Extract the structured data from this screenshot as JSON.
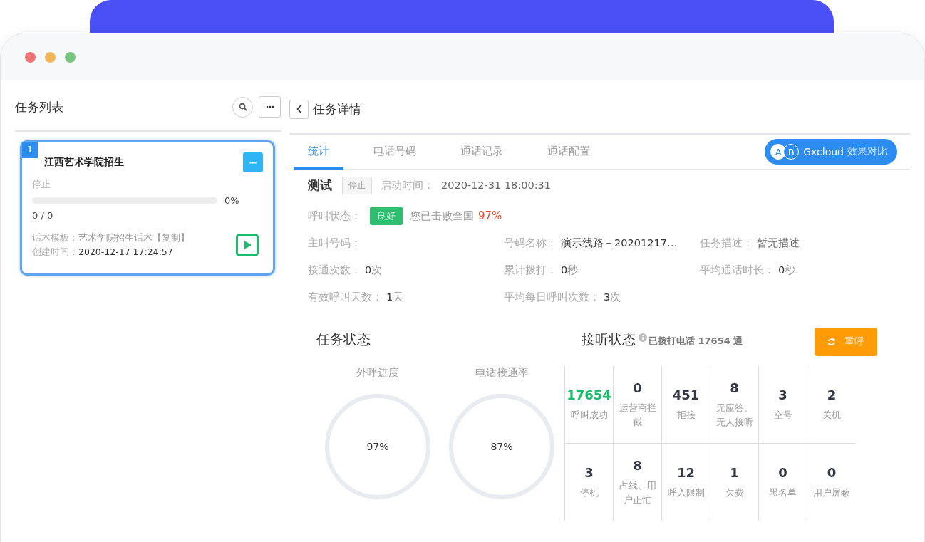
{
  "task_list": {
    "title": "任务列表",
    "tasks": [
      {
        "index": "1",
        "name": "江西艺术学院招生",
        "status": "停止",
        "level": 0,
        "percent": "0%",
        "count": "0 / 0",
        "script_label": "话术模板：",
        "script": "艺术学院招生话术【复制】",
        "created_label": "创建时间：",
        "created": "2020-12-17 17:24:57",
        "selected": true
      }
    ]
  },
  "detail": {
    "title": "任务详情",
    "tabs": [
      {
        "label": "统计",
        "selected": true
      },
      {
        "label": "电话号码",
        "selected": false
      },
      {
        "label": "通话记录",
        "selected": false
      },
      {
        "label": "通话配置",
        "selected": false
      }
    ],
    "compare_button": {
      "a": "A",
      "b": "B",
      "label": "Gxcloud",
      "suffix": "效果对比"
    },
    "task_name": "测试",
    "task_status": "停止",
    "start_label": "启动时间：",
    "start_time": "2020-12-31 18:00:31",
    "call_status_label": "呼叫状态：",
    "call_status": "良好",
    "beat_text": "您已击败全国",
    "beat_percent": "97%",
    "info_rows": [
      [
        {
          "label": "主叫号码："
        },
        {
          "label": "号码名称：",
          "value": "演示线路－20201217…"
        },
        {
          "label": "任务描述：",
          "value": "暂无描述",
          "muted": true
        }
      ],
      [
        {
          "label": "接通次数：",
          "value": "0",
          "unit": "次"
        },
        {
          "label": "累计拨打：",
          "value": "0",
          "unit": "秒"
        },
        {
          "label": "平均通话时长：",
          "value": "0",
          "unit": "秒"
        }
      ],
      [
        {
          "label": "有效呼叫天数：",
          "value": "1",
          "unit": "天"
        },
        {
          "label": "平均每日呼叫次数：",
          "value": "3",
          "unit": "次"
        }
      ]
    ],
    "task_state": {
      "title": "任务状态",
      "gauges": [
        {
          "title": "外呼进度",
          "value": "97%"
        },
        {
          "title": "电话接通率",
          "value": "87%"
        }
      ]
    },
    "answer_state": {
      "title": "接听状态",
      "info": "已拨打电话 17654 通",
      "redial": "重呼",
      "cells": [
        {
          "value": "17654",
          "label": "呼叫成功",
          "color": "#19be6b"
        },
        {
          "value": "0",
          "label": "运营商拦截",
          "color": "#333844"
        },
        {
          "value": "451",
          "label": "拒接",
          "color": "#333844"
        },
        {
          "value": "8",
          "label": "无应答、无人接听",
          "color": "#333844"
        },
        {
          "value": "3",
          "label": "空号",
          "color": "#333844"
        },
        {
          "value": "2",
          "label": "关机",
          "color": "#333844"
        },
        {
          "value": "3",
          "label": "停机",
          "color": "#333844"
        },
        {
          "value": "8",
          "label": "占线、用户正忙",
          "color": "#333844"
        },
        {
          "value": "12",
          "label": "呼入限制",
          "color": "#333844"
        },
        {
          "value": "1",
          "label": "欠费",
          "color": "#333844"
        },
        {
          "value": "0",
          "label": "黑名单",
          "color": "#333844"
        },
        {
          "value": "0",
          "label": "用户屏蔽",
          "color": "#333844"
        }
      ]
    }
  }
}
